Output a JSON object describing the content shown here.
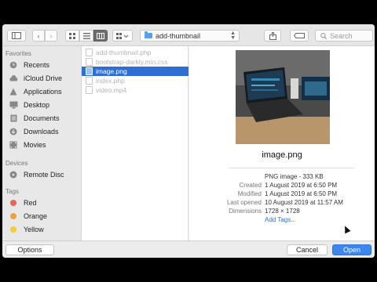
{
  "toolbar": {
    "path_label": "add-thumbnail",
    "search_placeholder": "Search"
  },
  "sidebar": {
    "favorites_heading": "Favorites",
    "favorites": [
      {
        "label": "Recents",
        "icon": "clock-icon"
      },
      {
        "label": "iCloud Drive",
        "icon": "cloud-icon"
      },
      {
        "label": "Applications",
        "icon": "applications-icon"
      },
      {
        "label": "Desktop",
        "icon": "desktop-icon"
      },
      {
        "label": "Documents",
        "icon": "documents-icon"
      },
      {
        "label": "Downloads",
        "icon": "downloads-icon"
      },
      {
        "label": "Movies",
        "icon": "movies-icon"
      }
    ],
    "devices_heading": "Devices",
    "devices": [
      {
        "label": "Remote Disc",
        "icon": "disc-icon"
      }
    ],
    "tags_heading": "Tags",
    "tags": [
      {
        "label": "Red",
        "color": "#e8645a"
      },
      {
        "label": "Orange",
        "color": "#f0a040"
      },
      {
        "label": "Yellow",
        "color": "#f2cc3a"
      }
    ]
  },
  "files": [
    {
      "name": "add-thumbnail.php",
      "selected": false
    },
    {
      "name": "bootstrap-darkly.min.css",
      "selected": false
    },
    {
      "name": "image.png",
      "selected": true
    },
    {
      "name": "index.php",
      "selected": false
    },
    {
      "name": "video.mp4",
      "selected": false
    }
  ],
  "preview": {
    "filename": "image.png",
    "kind": "PNG image - 333 KB",
    "info": [
      {
        "key": "Created",
        "value": "1 August 2019 at 6:50 PM"
      },
      {
        "key": "Modified",
        "value": "1 August 2019 at 6:50 PM"
      },
      {
        "key": "Last opened",
        "value": "10 August 2019 at 11:57 AM"
      },
      {
        "key": "Dimensions",
        "value": "1728 × 1728"
      }
    ],
    "add_tags": "Add Tags..."
  },
  "footer": {
    "options": "Options",
    "cancel": "Cancel",
    "open": "Open"
  },
  "colors": {
    "selection": "#2f6fd4",
    "primary_button": "#3d86f0",
    "link": "#2f6fd4"
  }
}
